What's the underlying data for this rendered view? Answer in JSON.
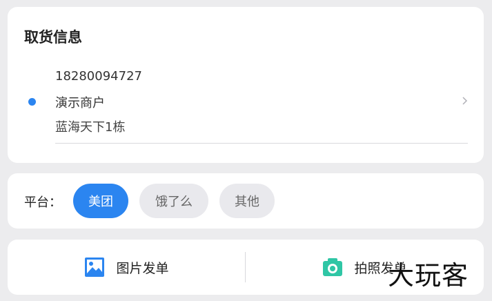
{
  "pickup": {
    "title": "取货信息",
    "phone": "18280094727",
    "name": "演示商户",
    "address": "蓝海天下1栋"
  },
  "platform": {
    "label": "平台：",
    "options": [
      {
        "label": "美团",
        "selected": true
      },
      {
        "label": "饿了么",
        "selected": false
      },
      {
        "label": "其他",
        "selected": false
      }
    ]
  },
  "actions": {
    "image_order_label": "图片发单",
    "photo_order_label": "拍照发单"
  },
  "watermark": "大玩客",
  "colors": {
    "accent": "#2b85f0",
    "image_icon": "#2b85f0",
    "camera_icon": "#2fc6a5"
  }
}
